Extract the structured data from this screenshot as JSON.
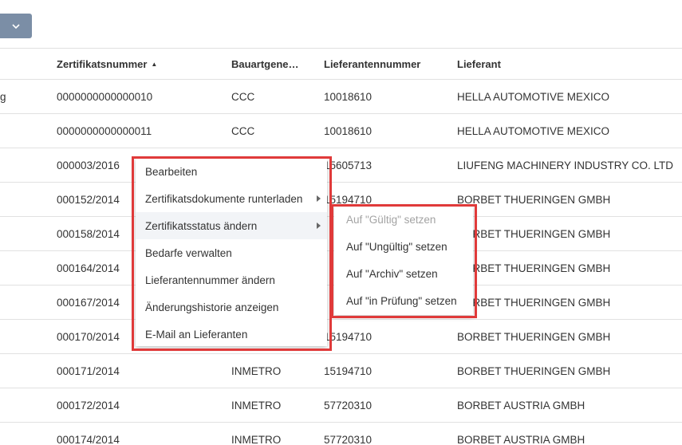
{
  "toolbar": {
    "dropdown_icon": "chevron-down-icon"
  },
  "table": {
    "columns": [
      "",
      "Zertifikatsnummer",
      "Bauartgene…",
      "Lieferantennummer",
      "Lieferant"
    ],
    "sort": {
      "column": "Zertifikatsnummer",
      "direction": "ascending",
      "icon": "sort-asc-icon"
    },
    "rows": [
      [
        "g",
        "0000000000000010",
        "CCC",
        "10018610",
        "HELLA AUTOMOTIVE MEXICO"
      ],
      [
        "",
        "0000000000000011",
        "CCC",
        "10018610",
        "HELLA AUTOMOTIVE MEXICO"
      ],
      [
        "",
        "000003/2016",
        "",
        "15605713",
        "LIUFENG MACHINERY INDUSTRY CO. LTD"
      ],
      [
        "",
        "000152/2014",
        "",
        "15194710",
        "BORBET THUERINGEN GMBH"
      ],
      [
        "",
        "000158/2014",
        "",
        "",
        "BORBET THUERINGEN GMBH"
      ],
      [
        "",
        "000164/2014",
        "",
        "",
        "BORBET THUERINGEN GMBH"
      ],
      [
        "",
        "000167/2014",
        "",
        "",
        "BORBET THUERINGEN GMBH"
      ],
      [
        "",
        "000170/2014",
        "",
        "15194710",
        "BORBET THUERINGEN GMBH"
      ],
      [
        "",
        "000171/2014",
        "INMETRO",
        "15194710",
        "BORBET THUERINGEN GMBH"
      ],
      [
        "",
        "000172/2014",
        "INMETRO",
        "57720310",
        "BORBET AUSTRIA GMBH"
      ],
      [
        "",
        "000174/2014",
        "INMETRO",
        "57720310",
        "BORBET AUSTRIA GMBH"
      ]
    ]
  },
  "context_menu": {
    "items": [
      {
        "label": "Bearbeiten"
      },
      {
        "label": "Zertifikatsdokumente runterladen",
        "submenu": true
      },
      {
        "label": "Zertifikatsstatus ändern",
        "submenu": true,
        "active": true
      },
      {
        "label": "Bedarfe verwalten"
      },
      {
        "label": "Lieferantennummer ändern"
      },
      {
        "label": "Änderungshistorie anzeigen"
      },
      {
        "label": "E-Mail an Lieferanten"
      }
    ]
  },
  "status_submenu": {
    "items": [
      {
        "label": "Auf \"Gültig\" setzen",
        "disabled": true
      },
      {
        "label": "Auf \"Ungültig\" setzen"
      },
      {
        "label": "Auf \"Archiv\" setzen"
      },
      {
        "label": "Auf \"in Prüfung\" setzen"
      }
    ]
  },
  "colors": {
    "highlight": "#e03a3a",
    "dropdown_bg": "#7b8ea6",
    "disabled_text": "#a3a3a3"
  }
}
